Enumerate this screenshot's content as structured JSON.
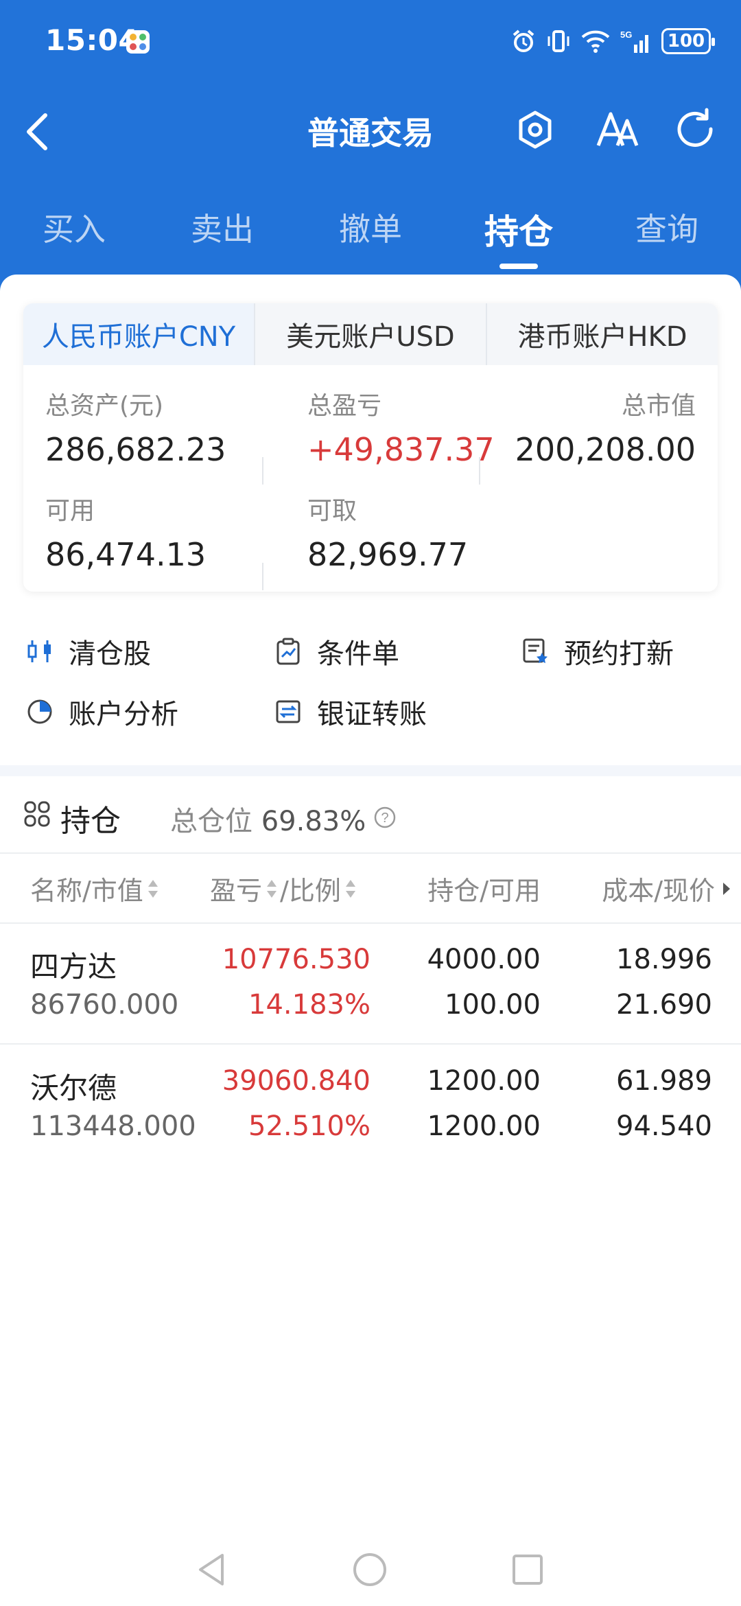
{
  "status": {
    "time": "15:04",
    "battery": "100"
  },
  "nav": {
    "title": "普通交易"
  },
  "tabs": [
    {
      "label": "买入",
      "active": false
    },
    {
      "label": "卖出",
      "active": false
    },
    {
      "label": "撤单",
      "active": false
    },
    {
      "label": "持仓",
      "active": true
    },
    {
      "label": "查询",
      "active": false
    }
  ],
  "account_tabs": [
    {
      "label": "人民币账户CNY",
      "active": true
    },
    {
      "label": "美元账户USD",
      "active": false
    },
    {
      "label": "港币账户HKD",
      "active": false
    }
  ],
  "metrics": {
    "total_assets_label": "总资产(元)",
    "total_assets": "286,682.23",
    "total_pl_label": "总盈亏",
    "total_pl": "+49,837.37",
    "market_value_label": "总市值",
    "market_value": "200,208.00",
    "available_label": "可用",
    "available": "86,474.13",
    "withdrawable_label": "可取",
    "withdrawable": "82,969.77"
  },
  "shortcuts": {
    "clear": "清仓股",
    "conditional": "条件单",
    "ipo": "预约打新",
    "analysis": "账户分析",
    "transfer": "银证转账"
  },
  "holdings": {
    "title": "持仓",
    "ratio_label": "总仓位",
    "ratio": "69.83%",
    "columns": {
      "name": "名称/市值",
      "pl_a": "盈亏",
      "pl_b": "/比例",
      "position": "持仓/可用",
      "cost": "成本/现价"
    },
    "rows": [
      {
        "name": "四方达",
        "market_value": "86760.000",
        "pl": "10776.530",
        "pl_ratio": "14.183%",
        "position": "4000.00",
        "available": "100.00",
        "cost": "18.996",
        "price": "21.690"
      },
      {
        "name": "沃尔德",
        "market_value": "113448.000",
        "pl": "39060.840",
        "pl_ratio": "52.510%",
        "position": "1200.00",
        "available": "1200.00",
        "cost": "61.989",
        "price": "94.540"
      }
    ]
  },
  "colors": {
    "brand": "#2273d9",
    "up": "#d83a3a",
    "accent": "#1f6fd6"
  }
}
